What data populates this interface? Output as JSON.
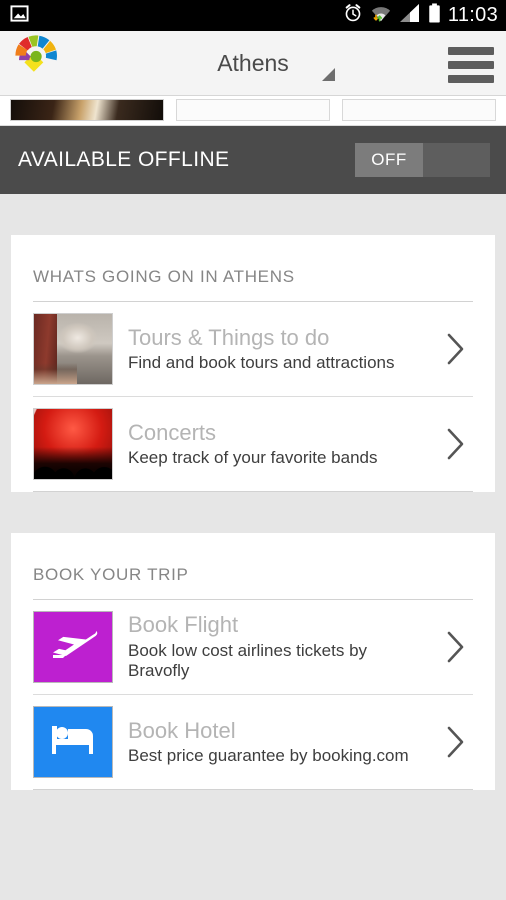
{
  "status_bar": {
    "time": "11:03",
    "icons": {
      "left": "image-icon",
      "alarm": "alarm-clock-icon",
      "wifi": "wifi-data-icon",
      "signal": "signal-bars-icon",
      "battery": "battery-full-icon"
    }
  },
  "app_bar": {
    "logo": "app-logo-pin-icon",
    "title": "Athens",
    "dropdown": "dropdown-caret-icon",
    "menu": "hamburger-menu-icon"
  },
  "offline": {
    "label": "AVAILABLE OFFLINE",
    "toggle_state": "OFF"
  },
  "sections": [
    {
      "title": "WHATS GOING ON IN ATHENS",
      "rows": [
        {
          "heading": "Tours & Things to do",
          "subtitle": "Find and book tours and attractions",
          "thumb": "tours-photo-thumbnail",
          "chevron": "chevron-right-icon"
        },
        {
          "heading": "Concerts",
          "subtitle": "Keep track of your favorite bands",
          "thumb": "concert-photo-thumbnail",
          "chevron": "chevron-right-icon"
        }
      ]
    },
    {
      "title": "BOOK YOUR TRIP",
      "rows": [
        {
          "heading": "Book Flight",
          "subtitle": "Book low cost airlines tickets by Bravofly",
          "thumb": "airplane-icon",
          "chevron": "chevron-right-icon"
        },
        {
          "heading": "Book Hotel",
          "subtitle": "Best price guarantee by booking.com",
          "thumb": "bed-icon",
          "chevron": "chevron-right-icon"
        }
      ]
    }
  ],
  "colors": {
    "page_background": "#e6e6e6",
    "app_bar": "#f4f4f4",
    "offline_bar": "#4b4b4b",
    "flight_tile": "#bd20d0",
    "hotel_tile": "#2088f0",
    "heading_text": "#b4b4b4",
    "subtitle_text": "#3e3e3e"
  }
}
